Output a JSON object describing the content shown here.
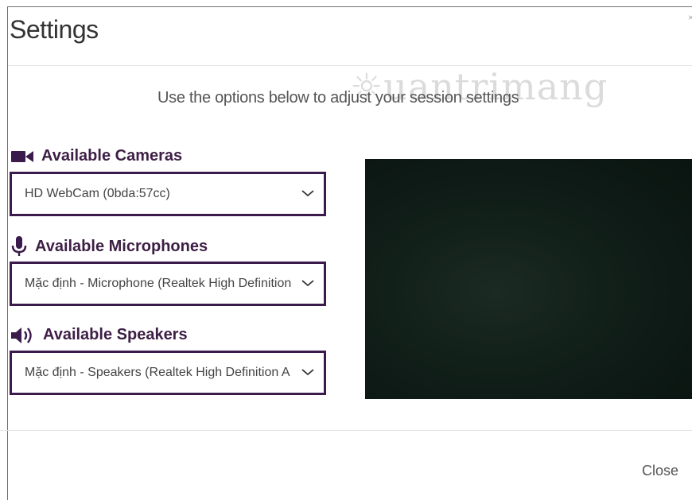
{
  "dialog": {
    "title": "Settings",
    "description": "Use the options below to adjust your session settings",
    "watermark": "Quantrimang",
    "close_label": "Close"
  },
  "cameras": {
    "label": "Available Cameras",
    "icon": "video-camera-icon",
    "selected": "HD WebCam (0bda:57cc)"
  },
  "microphones": {
    "label": "Available Microphones",
    "icon": "microphone-icon",
    "selected": "Mặc định - Microphone (Realtek High Definition"
  },
  "speakers": {
    "label": "Available Speakers",
    "icon": "speaker-icon",
    "selected": "Mặc định - Speakers (Realtek High Definition A"
  },
  "colors": {
    "accent": "#3b1b4b",
    "label_text": "#3d1e45",
    "preview_bg": "#0f1c17"
  }
}
